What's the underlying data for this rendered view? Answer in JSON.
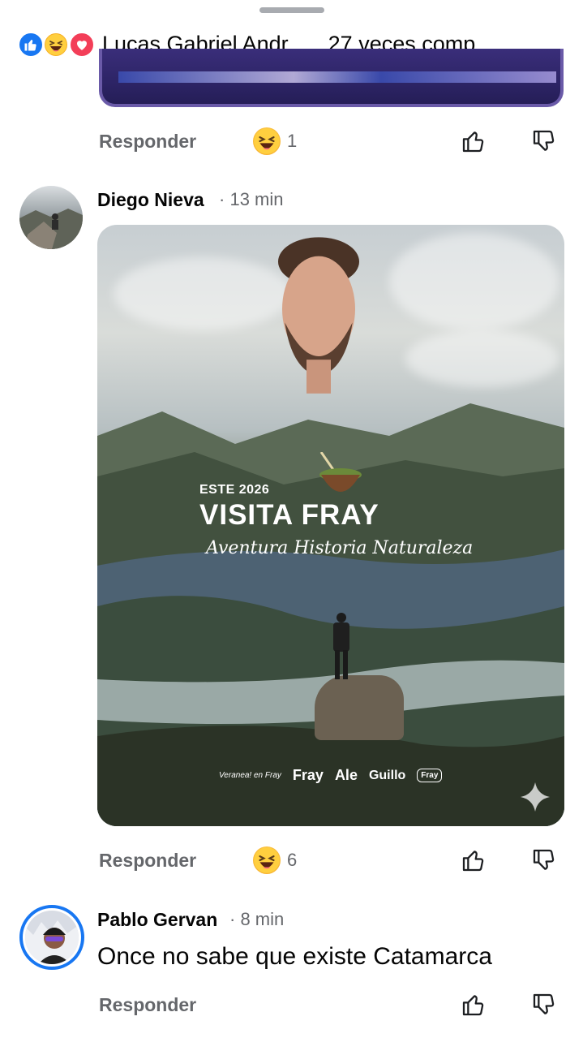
{
  "header": {
    "name": "Lucas Gabriel Andr...",
    "shares": "27 veces comp...",
    "reaction_icons": [
      "like-icon",
      "haha-icon",
      "love-icon"
    ]
  },
  "previous_comment": {
    "reply_label": "Responder",
    "reaction_count": "1"
  },
  "comment_diego": {
    "name": "Diego Nieva",
    "time": "13 min",
    "image_text": {
      "line1": "ESTE 2026",
      "line2": "VISITA FRAY",
      "line3": "Aventura Historia Naturaleza",
      "logo_1": "Veranea! en Fray",
      "logo_2": "Fray",
      "logo_3": "Ale",
      "logo_4": "Guillo",
      "logo_5": "Fray"
    },
    "reply_label": "Responder",
    "reaction_count": "6"
  },
  "comment_pablo": {
    "name": "Pablo Gervan",
    "time": "8 min",
    "text": "Once no sabe que existe Catamarca",
    "reply_label": "Responder"
  },
  "colors": {
    "like": "#1877f2",
    "haha": "#f7b125",
    "love": "#f33e58",
    "secondary_text": "#65676b",
    "avatar_ring": "#1877f2"
  }
}
